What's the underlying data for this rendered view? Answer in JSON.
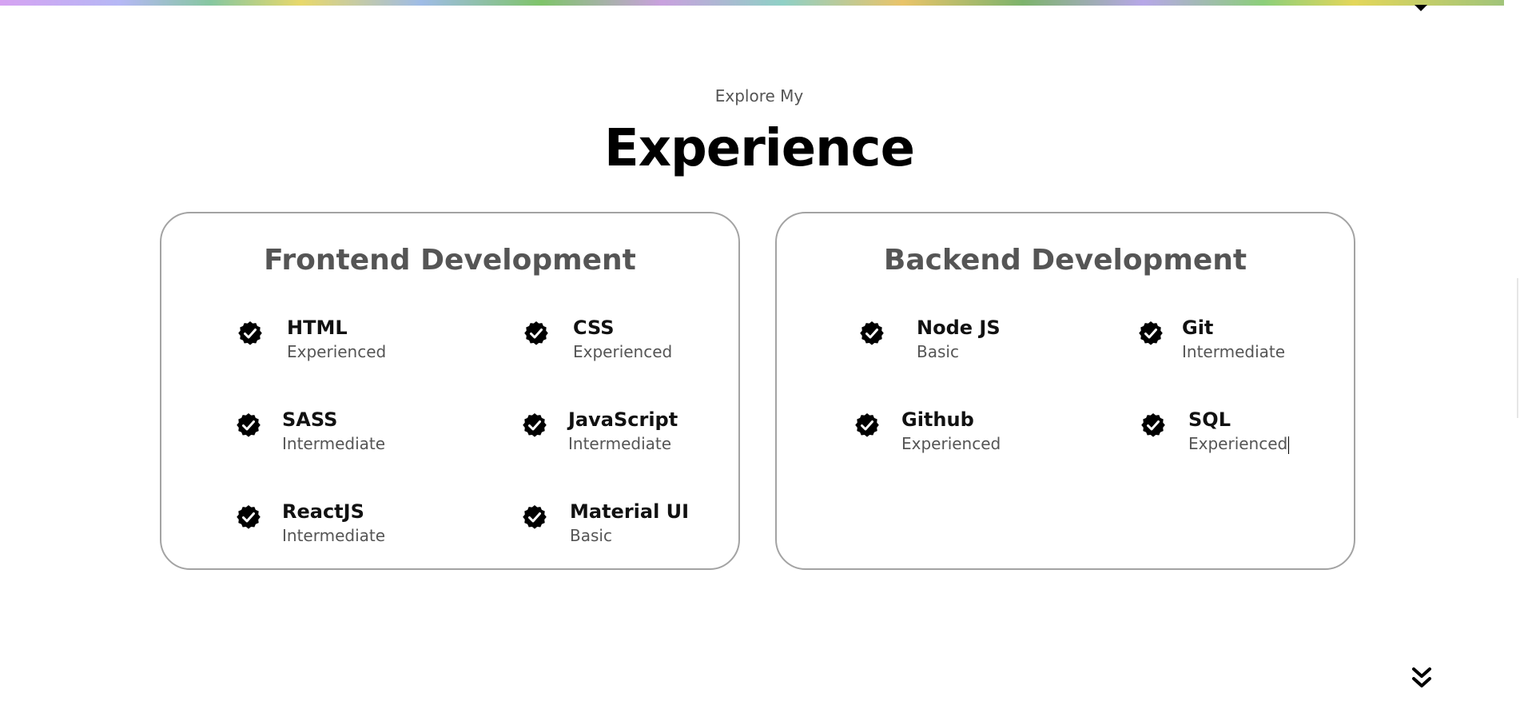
{
  "header": {
    "subtitle": "Explore My",
    "title": "Experience"
  },
  "frontend": {
    "title": "Frontend Development",
    "skills": [
      {
        "name": "HTML",
        "level": "Experienced"
      },
      {
        "name": "CSS",
        "level": "Experienced"
      },
      {
        "name": "SASS",
        "level": "Intermediate"
      },
      {
        "name": "JavaScript",
        "level": "Intermediate"
      },
      {
        "name": "ReactJS",
        "level": "Intermediate"
      },
      {
        "name": "Material UI",
        "level": "Basic"
      }
    ]
  },
  "backend": {
    "title": "Backend Development",
    "skills": [
      {
        "name": "Node JS",
        "level": "Basic"
      },
      {
        "name": "Git",
        "level": "Intermediate"
      },
      {
        "name": "Github",
        "level": "Experienced"
      },
      {
        "name": "SQL",
        "level": "Experienced"
      }
    ]
  },
  "icons": {
    "check": "check-badge-icon",
    "scroll_down": "double-chevron-down-icon",
    "top_arrow": "caret-down-icon"
  },
  "colors": {
    "text": "#000000",
    "muted": "#555555",
    "card_border": "#a3a3a3"
  }
}
